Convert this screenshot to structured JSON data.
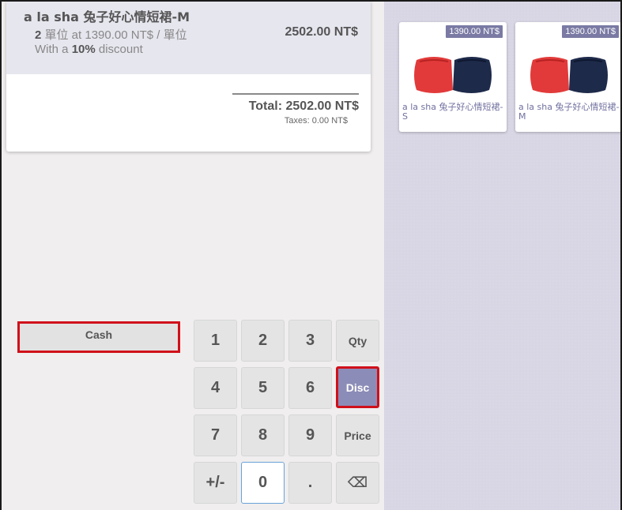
{
  "order": {
    "line": {
      "product_name": "a la sha 兔子好心情短裙-M",
      "quantity": "2",
      "unit_text": " 單位 at 1390.00 NT$ / 單位",
      "discount_prefix": "With a ",
      "discount_value": "10%",
      "discount_suffix": " discount",
      "price": "2502.00 NT$"
    },
    "total_label": "Total: 2502.00 NT$",
    "taxes_label": "Taxes: 0.00 NT$"
  },
  "payment": {
    "cash_label": "Cash"
  },
  "numpad": {
    "k1": "1",
    "k2": "2",
    "k3": "3",
    "qty": "Qty",
    "k4": "4",
    "k5": "5",
    "k6": "6",
    "disc": "Disc",
    "k7": "7",
    "k8": "8",
    "k9": "9",
    "price": "Price",
    "plusminus": "+/-",
    "k0": "0",
    "dot": ".",
    "backspace": "⌫"
  },
  "products": [
    {
      "price": "1390.00 NT$",
      "label": "a la sha 兔子好心情短裙-S"
    },
    {
      "price": "1390.00 NT$",
      "label": "a la sha 兔子好心情短裙-M"
    }
  ],
  "colors": {
    "selected_key": "#8c8cb8",
    "highlight_border": "#d0101a",
    "price_tag": "#7a7aa4"
  }
}
